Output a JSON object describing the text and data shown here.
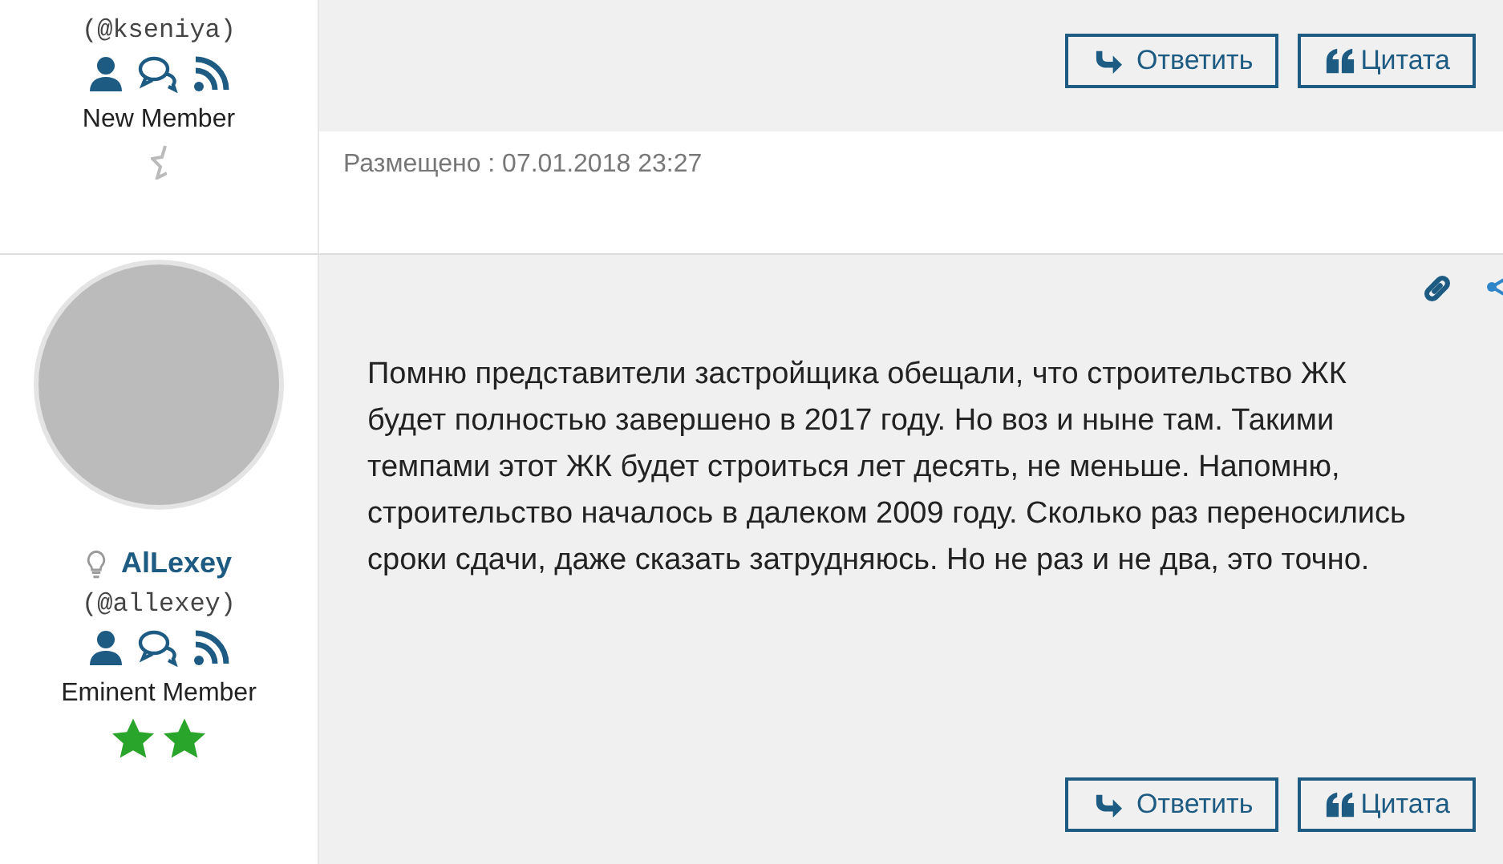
{
  "posts": [
    {
      "handle": "(@kseniya)",
      "rank": "New Member",
      "rank_icons": [
        {
          "kind": "broken-star"
        }
      ],
      "actions": [
        {
          "kind": "reply",
          "label": "Ответить"
        },
        {
          "kind": "quote",
          "label": "Цитата"
        }
      ],
      "posted": "Размещено : 07.01.2018 23:27"
    },
    {
      "author": "AlLexey",
      "handle": "(@allexey)",
      "rank": "Eminent Member",
      "rank_icons": [
        {
          "kind": "star"
        },
        {
          "kind": "star"
        }
      ],
      "text": "Помню представители застройщика обещали, что строительство ЖК будет полностью завершено в 2017 году. Но воз и ныне там. Такими темпами этот ЖК будет строиться лет десять, не меньше. Напомню, строительство началось в далеком 2009 году. Сколько раз переносились сроки сдачи, даже сказать затрудняюсь. Но не раз и не два, это точно.",
      "actions": [
        {
          "kind": "reply",
          "label": "Ответить"
        },
        {
          "kind": "quote",
          "label": "Цитата"
        }
      ]
    }
  ]
}
